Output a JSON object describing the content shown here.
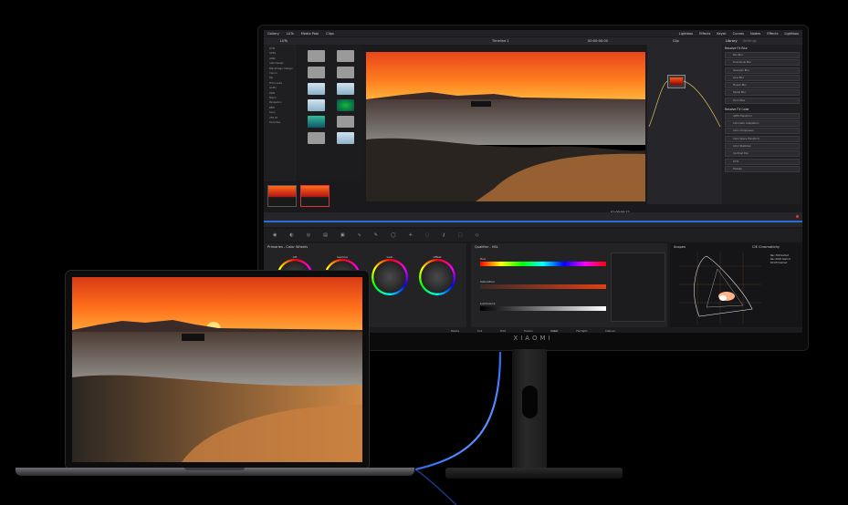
{
  "monitor": {
    "brand": "XIAOMI",
    "app": {
      "topbar": {
        "left": [
          "Gallery",
          "LUTs",
          "Media Pool",
          "Clips"
        ],
        "right": [
          "Lightbox",
          "Effects",
          "Keyer",
          "Curves",
          "Nodes",
          "Effects",
          "Lightbox"
        ]
      },
      "panel_labels": {
        "luts": "LUTs",
        "timeline": "Timeline 1",
        "timecode": "00:00:00:00",
        "clip": "Clip",
        "library": "Library",
        "settings": "Settings"
      },
      "media_tree": [
        "LUTs",
        "ACES",
        "ARRI",
        "Astrodesign",
        "Blackmagic Design",
        "Canon",
        "DJI",
        "Film Looks",
        "GoPro",
        "HDR",
        "Nikon",
        "Panasonic",
        "RED",
        "Sony",
        "VFX IO",
        "Favorites"
      ],
      "library": {
        "heading_blur": "Resolve FX Blur",
        "blur_items": [
          "Box Blur",
          "Directional Blur",
          "Gaussian Blur",
          "Lens Blur",
          "Mosaic Blur",
          "Radial Blur",
          "Zoom Blur"
        ],
        "heading_color": "Resolve FX Color",
        "color_items": [
          "ACES Transform",
          "Chromatic Adaptation",
          "Color Compressor",
          "Color Space Transform",
          "Color Stabilizer",
          "Contrast Pop",
          "DCTL",
          "Dehaze"
        ]
      },
      "viewer_timecode": "01:00:00:12",
      "color_panels": {
        "wheels_title": "Primaries - Color Wheels",
        "wheel_labels": [
          "Lift",
          "Gamma",
          "Gain",
          "Offset"
        ],
        "qualifier_title": "Qualifier - HSL",
        "qualifier_rows": [
          "Hue",
          "Saturation",
          "Luminance"
        ],
        "scopes_title": "Scopes",
        "scopes_mode": "CIE Chromaticity",
        "scope_legend": [
          "Rec.709 Gamut",
          "Rec.2020 Gamut",
          "DCI-P3 Gamut"
        ]
      },
      "pages": [
        "Media",
        "Cut",
        "Edit",
        "Fusion",
        "Color",
        "Fairlight",
        "Deliver"
      ]
    }
  },
  "laptop": {}
}
